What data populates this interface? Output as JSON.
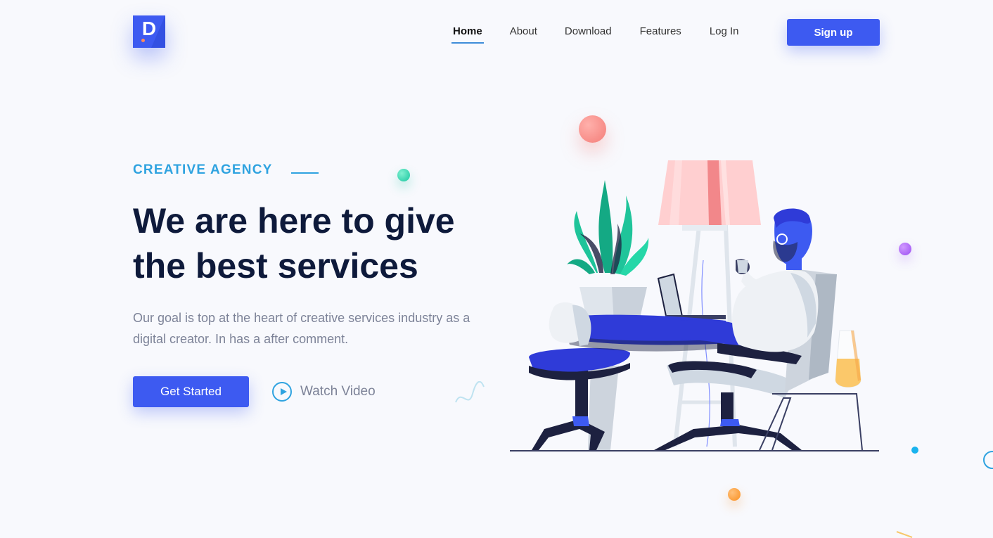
{
  "brand": {
    "logo_letter": "D"
  },
  "nav": {
    "items": [
      {
        "label": "Home",
        "active": true
      },
      {
        "label": "About"
      },
      {
        "label": "Download"
      },
      {
        "label": "Features"
      },
      {
        "label": "Log In"
      }
    ],
    "signup_label": "Sign up"
  },
  "hero": {
    "eyebrow": "CREATIVE AGENCY",
    "headline": "We are here to give the best services",
    "description": "Our goal is top at the heart of creative services industry as a digital creator. In has a after comment.",
    "cta_label": "Get Started",
    "video_label": "Watch Video"
  },
  "colors": {
    "primary": "#3d5af1",
    "accent": "#2fa3e0",
    "heading": "#0e1a3b",
    "body": "#7d8398"
  }
}
